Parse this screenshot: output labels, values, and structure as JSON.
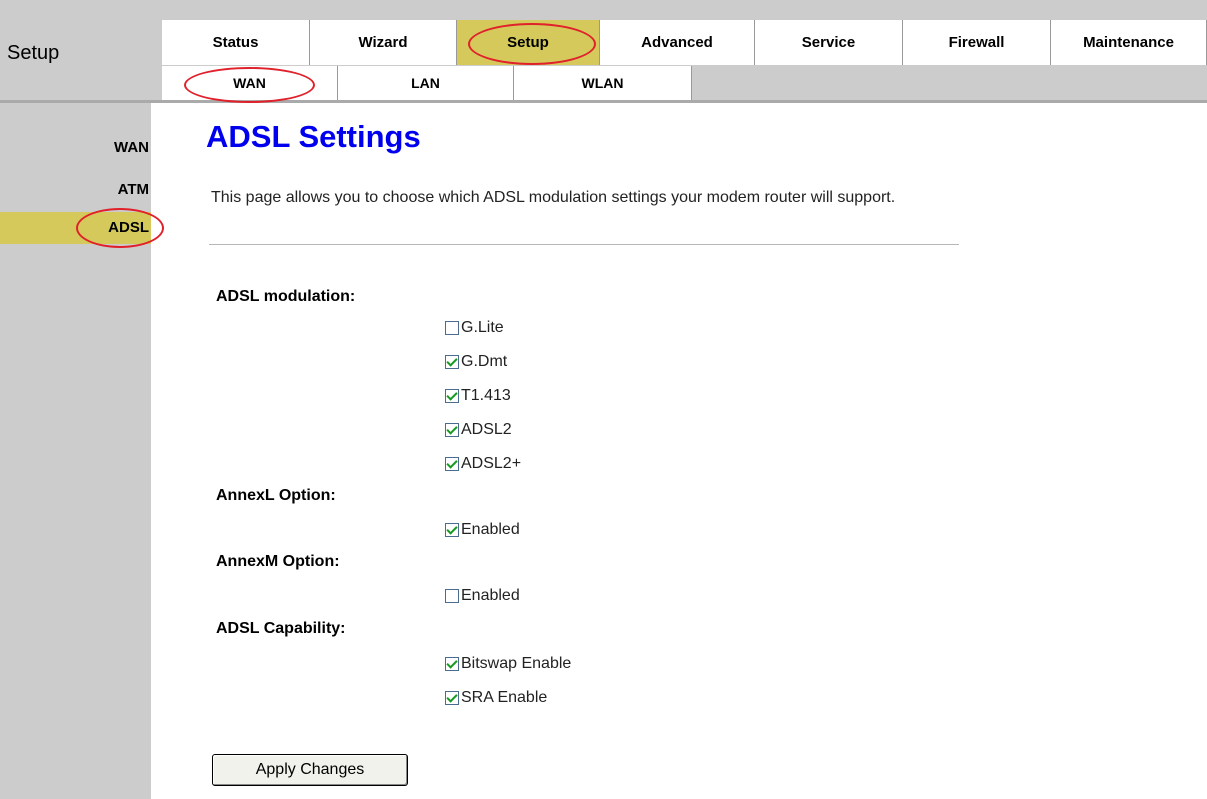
{
  "section_title": "Setup",
  "top_nav": [
    {
      "label": "Status"
    },
    {
      "label": "Wizard"
    },
    {
      "label": "Setup"
    },
    {
      "label": "Advanced"
    },
    {
      "label": "Service"
    },
    {
      "label": "Firewall"
    },
    {
      "label": "Maintenance"
    }
  ],
  "sub_nav": [
    {
      "label": "WAN"
    },
    {
      "label": "LAN"
    },
    {
      "label": "WLAN"
    }
  ],
  "sidebar": [
    {
      "label": "WAN"
    },
    {
      "label": "ATM"
    },
    {
      "label": "ADSL"
    }
  ],
  "page": {
    "title": "ADSL Settings",
    "description": "This page allows you to choose which ADSL modulation settings your modem router will support."
  },
  "form": {
    "modulation": {
      "label": "ADSL modulation:",
      "options": [
        {
          "label": "G.Lite",
          "checked": false
        },
        {
          "label": "G.Dmt",
          "checked": true
        },
        {
          "label": "T1.413",
          "checked": true
        },
        {
          "label": "ADSL2",
          "checked": true
        },
        {
          "label": "ADSL2+",
          "checked": true
        }
      ]
    },
    "annex_l": {
      "label": "AnnexL Option:",
      "option": "Enabled",
      "checked": true
    },
    "annex_m": {
      "label": "AnnexM Option:",
      "option": "Enabled",
      "checked": false
    },
    "capability": {
      "label": "ADSL Capability:",
      "options": [
        {
          "label": "Bitswap Enable",
          "checked": true
        },
        {
          "label": "SRA Enable",
          "checked": true
        }
      ]
    },
    "apply_label": "Apply Changes"
  },
  "colors": {
    "active_tab": "#d4c95a",
    "title_blue": "#0000ee",
    "annotation_red": "#e0202a"
  }
}
